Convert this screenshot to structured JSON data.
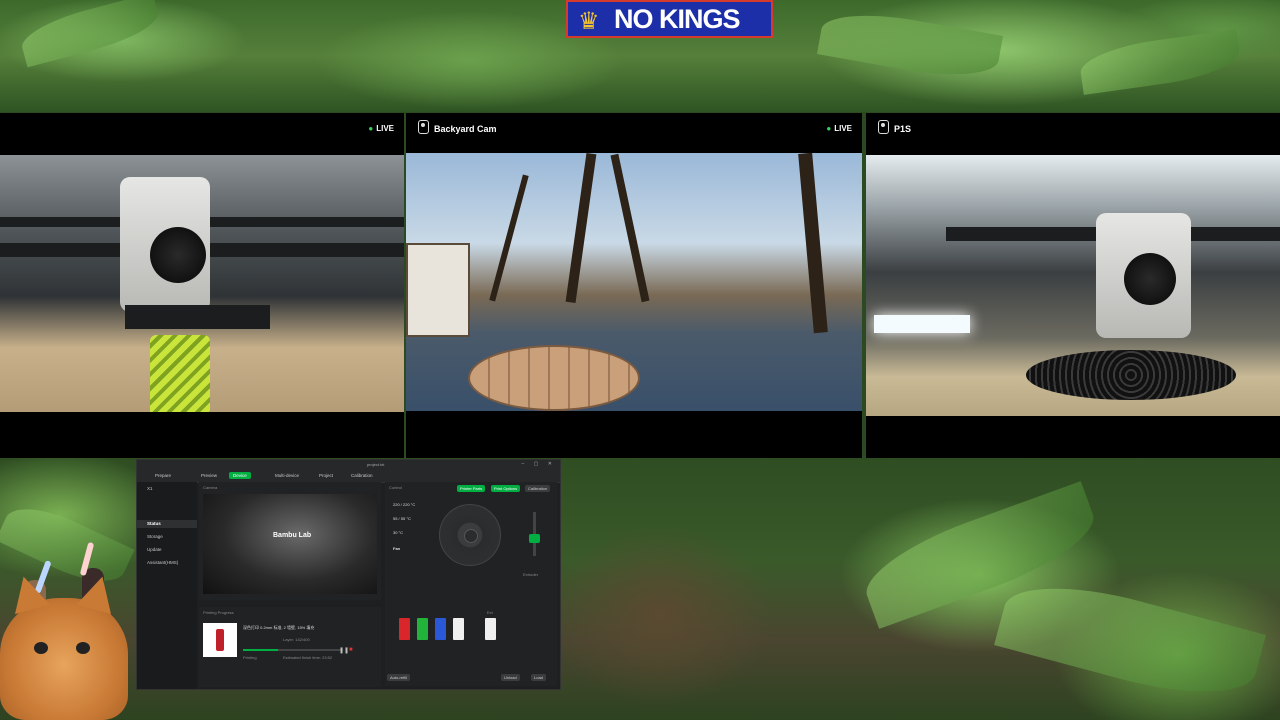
{
  "overlay": {
    "logo_text": "NO KINGS"
  },
  "cameras": [
    {
      "name": "",
      "status": "LIVE"
    },
    {
      "name": "Backyard Cam",
      "status": "LIVE"
    },
    {
      "name": "P1S",
      "status": ""
    }
  ],
  "bambu_app": {
    "window_title": "project.txt",
    "tabs": [
      "Prepare",
      "Preview",
      "Device",
      "Multi-device",
      "Project",
      "Calibration"
    ],
    "active_tab": "Device",
    "printer_name": "X1",
    "sidebar": [
      "Status",
      "Storage",
      "Update",
      "Assistant(HMS)"
    ],
    "active_sidebar": "Status",
    "camera_label": "Camera",
    "camera_logo": "Bambu Lab",
    "printing_label": "Printing Progress",
    "job_title": "深色打印 0.2mm 标准, 2 墙壁, 15% 填充",
    "layer_text": "Layer: 142/400",
    "remaining_text": "Estimated finish time: 23:52",
    "stage_text": "Printing",
    "progress_percent": 35,
    "control_label": "Control",
    "control_buttons": [
      "Printer Parts",
      "Print Options",
      "Calibration"
    ],
    "temps": [
      "220 / 220 °C",
      "55 / 55 °C",
      "30 °C"
    ],
    "fan_label": "Fan",
    "extruder_label": "Extruder",
    "ext_label": "Ext",
    "bottom_buttons": [
      "Auto-refill",
      "Unload",
      "Load"
    ],
    "spools": [
      {
        "color": "#d8262a",
        "label": "PLA"
      },
      {
        "color": "#22b33a",
        "label": "PLA"
      },
      {
        "color": "#2a58d6",
        "label": "PLA"
      },
      {
        "color": "#f0f0f0",
        "label": "PLA"
      }
    ]
  }
}
